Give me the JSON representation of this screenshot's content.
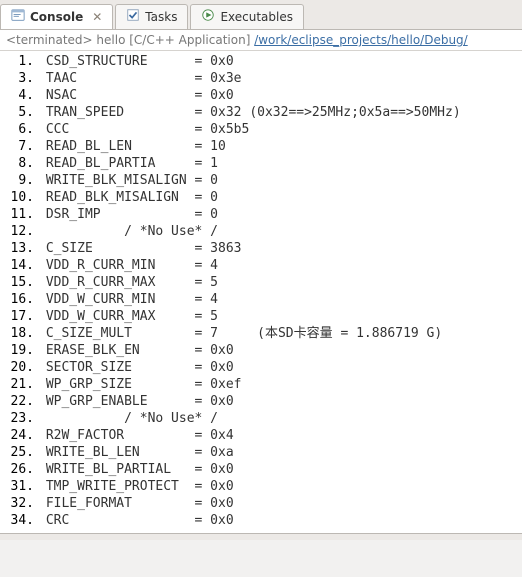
{
  "tabs": [
    {
      "label": "Console",
      "active": true,
      "hasClose": true
    },
    {
      "label": "Tasks",
      "active": false
    },
    {
      "label": "Executables",
      "active": false
    }
  ],
  "header": {
    "prefix": "<terminated> hello [C/C++ Application] ",
    "path": "/work/eclipse_projects/hello/Debug/"
  },
  "rows": [
    {
      "n": "1",
      "name": "CSD_STRUCTURE",
      "val": "0x0"
    },
    {
      "n": "3",
      "name": "TAAC",
      "val": "0x3e"
    },
    {
      "n": "4",
      "name": "NSAC",
      "val": "0x0"
    },
    {
      "n": "5",
      "name": "TRAN_SPEED",
      "val": "0x32",
      "extra": "(0x32==>25MHz;0x5a==>50MHz)"
    },
    {
      "n": "6",
      "name": "CCC",
      "val": "0x5b5"
    },
    {
      "n": "7",
      "name": "READ_BL_LEN",
      "val": "10"
    },
    {
      "n": "8",
      "name": "READ_BL_PARTIA",
      "val": "1"
    },
    {
      "n": "9",
      "name": "WRITE_BLK_MISALIGN",
      "val": "0"
    },
    {
      "n": "10",
      "name": "READ_BLK_MISALIGN",
      "val": "0"
    },
    {
      "n": "11",
      "name": "DSR_IMP",
      "val": "0"
    },
    {
      "n": "12",
      "sep": "/ *No Use* /"
    },
    {
      "n": "13",
      "name": "C_SIZE",
      "val": "3863"
    },
    {
      "n": "14",
      "name": "VDD_R_CURR_MIN",
      "val": "4"
    },
    {
      "n": "15",
      "name": "VDD_R_CURR_MAX",
      "val": "5"
    },
    {
      "n": "16",
      "name": "VDD_W_CURR_MIN",
      "val": "4"
    },
    {
      "n": "17",
      "name": "VDD_W_CURR_MAX",
      "val": "5"
    },
    {
      "n": "18",
      "name": "C_SIZE_MULT",
      "val": "7",
      "extra": "    (本SD卡容量 = 1.886719 G)"
    },
    {
      "n": "19",
      "name": "ERASE_BLK_EN",
      "val": "0x0"
    },
    {
      "n": "20",
      "name": "SECTOR_SIZE",
      "val": "0x0"
    },
    {
      "n": "21",
      "name": "WP_GRP_SIZE",
      "val": "0xef"
    },
    {
      "n": "22",
      "name": "WP_GRP_ENABLE",
      "val": "0x0"
    },
    {
      "n": "23",
      "sep": "/ *No Use* /"
    },
    {
      "n": "24",
      "name": "R2W_FACTOR",
      "val": "0x4"
    },
    {
      "n": "25",
      "name": "WRITE_BL_LEN",
      "val": "0xa"
    },
    {
      "n": "26",
      "name": "WRITE_BL_PARTIAL",
      "val": "0x0"
    },
    {
      "n": "31",
      "name": "TMP_WRITE_PROTECT",
      "val": "0x0"
    },
    {
      "n": "32",
      "name": "FILE_FORMAT",
      "val": "0x0"
    },
    {
      "n": "34",
      "name": "CRC",
      "val": "0x0"
    }
  ]
}
